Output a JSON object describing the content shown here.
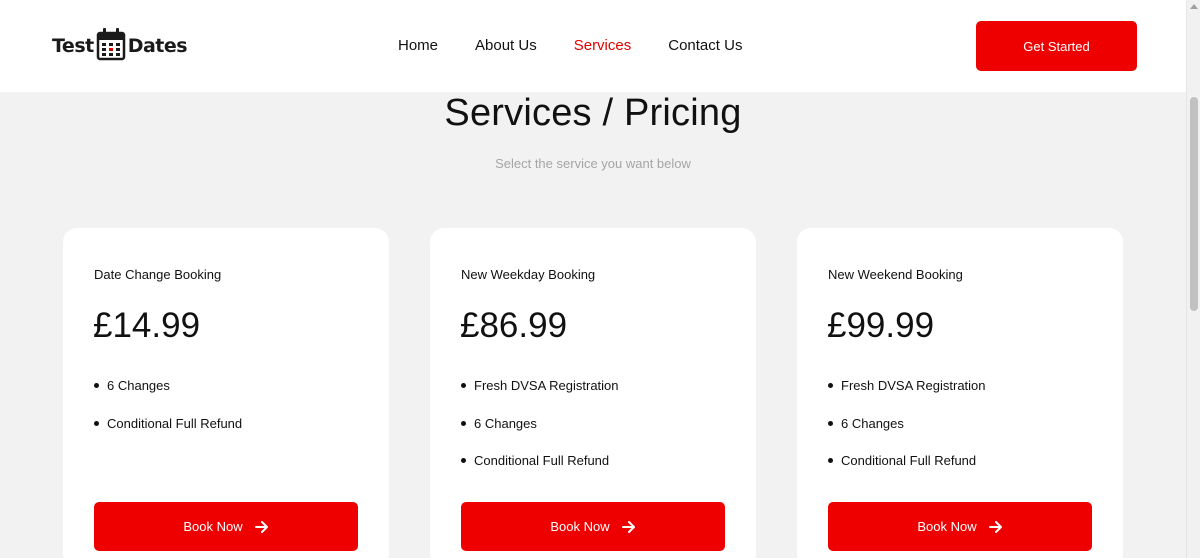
{
  "header": {
    "logo": {
      "left_text": "Test",
      "right_text": "Dates"
    },
    "nav": [
      {
        "label": "Home",
        "active": false
      },
      {
        "label": "About Us",
        "active": false
      },
      {
        "label": "Services",
        "active": true
      },
      {
        "label": "Contact Us",
        "active": false
      }
    ],
    "cta_label": "Get Started"
  },
  "main": {
    "title": "Services / Pricing",
    "subtitle": "Select the service you want below"
  },
  "cards": [
    {
      "name": "Date Change Booking",
      "price": "£14.99",
      "features": [
        "6 Changes",
        "Conditional Full Refund"
      ],
      "button": "Book Now"
    },
    {
      "name": "New Weekday Booking",
      "price": "£86.99",
      "features": [
        "Fresh DVSA Registration",
        "6 Changes",
        "Conditional Full Refund"
      ],
      "button": "Book Now"
    },
    {
      "name": "New Weekend Booking",
      "price": "£99.99",
      "features": [
        "Fresh DVSA Registration",
        "6 Changes",
        "Conditional Full Refund"
      ],
      "button": "Book Now"
    }
  ],
  "icons": {
    "logo": "calendar-icon",
    "button_arrow": "arrow-right-icon"
  },
  "colors": {
    "accent": "#ee0000",
    "nav_active": "#e00000",
    "background": "#f2f2f2",
    "card": "#ffffff",
    "subtitle": "#a5a5a5"
  }
}
